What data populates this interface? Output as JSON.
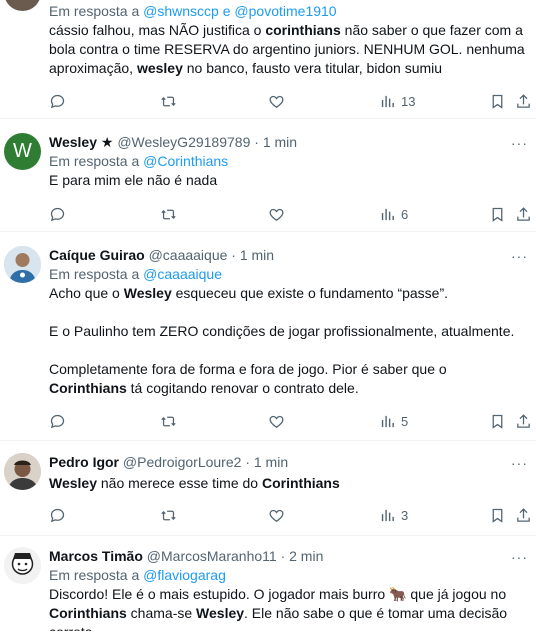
{
  "tweets": [
    {
      "reply_prefix": "Em resposta a",
      "reply_to": "@shwnsccp",
      "reply_join": "e",
      "reply_to2": "@povotime1910",
      "text_a1": "cássio falhou, mas NÃO justifica o ",
      "text_b1": "corinthians",
      "text_a2": " não saber o que fazer com a bola contra o time RESERVA do argentino juniors. NENHUM GOL. nenhuma aproximação, ",
      "text_b2": "wesley",
      "text_a3": " no banco, fausto vera titular, bidon sumiu",
      "views": "13"
    },
    {
      "name": "Wesley ★",
      "handle": "@WesleyG29189789",
      "time": "· 1 min",
      "avatar_letter": "W",
      "avatar_color": "#2e7d32",
      "reply_prefix": "Em resposta a",
      "reply_to": "@Corinthians",
      "text": "E para mim ele não é nada",
      "views": "6"
    },
    {
      "name": "Caíque Guirao",
      "handle": "@caaaaique",
      "time": "· 1 min",
      "reply_prefix": "Em resposta a",
      "reply_to": "@caaaaique",
      "p1_a": "Acho que o ",
      "p1_b": "Wesley",
      "p1_c": " esqueceu que existe o fundamento “passe”.",
      "p2": "E o Paulinho tem ZERO condições de jogar profissionalmente, atualmente.",
      "p3_a": "Completamente fora de forma e fora de jogo. Pior é saber que o ",
      "p3_b": "Corinthians",
      "p3_c": " tá cogitando renovar o contrato dele.",
      "views": "5"
    },
    {
      "name": "Pedro Igor",
      "handle": "@PedroigorLoure2",
      "time": "· 1 min",
      "t_a": "Wesley",
      "t_b": " não merece esse time do ",
      "t_c": "Corinthians",
      "views": "3"
    },
    {
      "name": "Marcos Timão",
      "handle": "@MarcosMaranho11",
      "time": "· 2 min",
      "reply_prefix": "Em resposta a",
      "reply_to": "@flaviogarag",
      "l1_a": "Discordo! Ele é o mais estupido. O jogador mais burro ",
      "l1_emoji": "🐂",
      "l1_c": " que já jogou no",
      "l2_a": "Corinthians",
      "l2_b": " chama-se ",
      "l2_c": "Wesley",
      "l2_d": ". Ele não sabe o que é tomar  uma decisão",
      "l3": "correta"
    }
  ],
  "more_glyph": "···"
}
